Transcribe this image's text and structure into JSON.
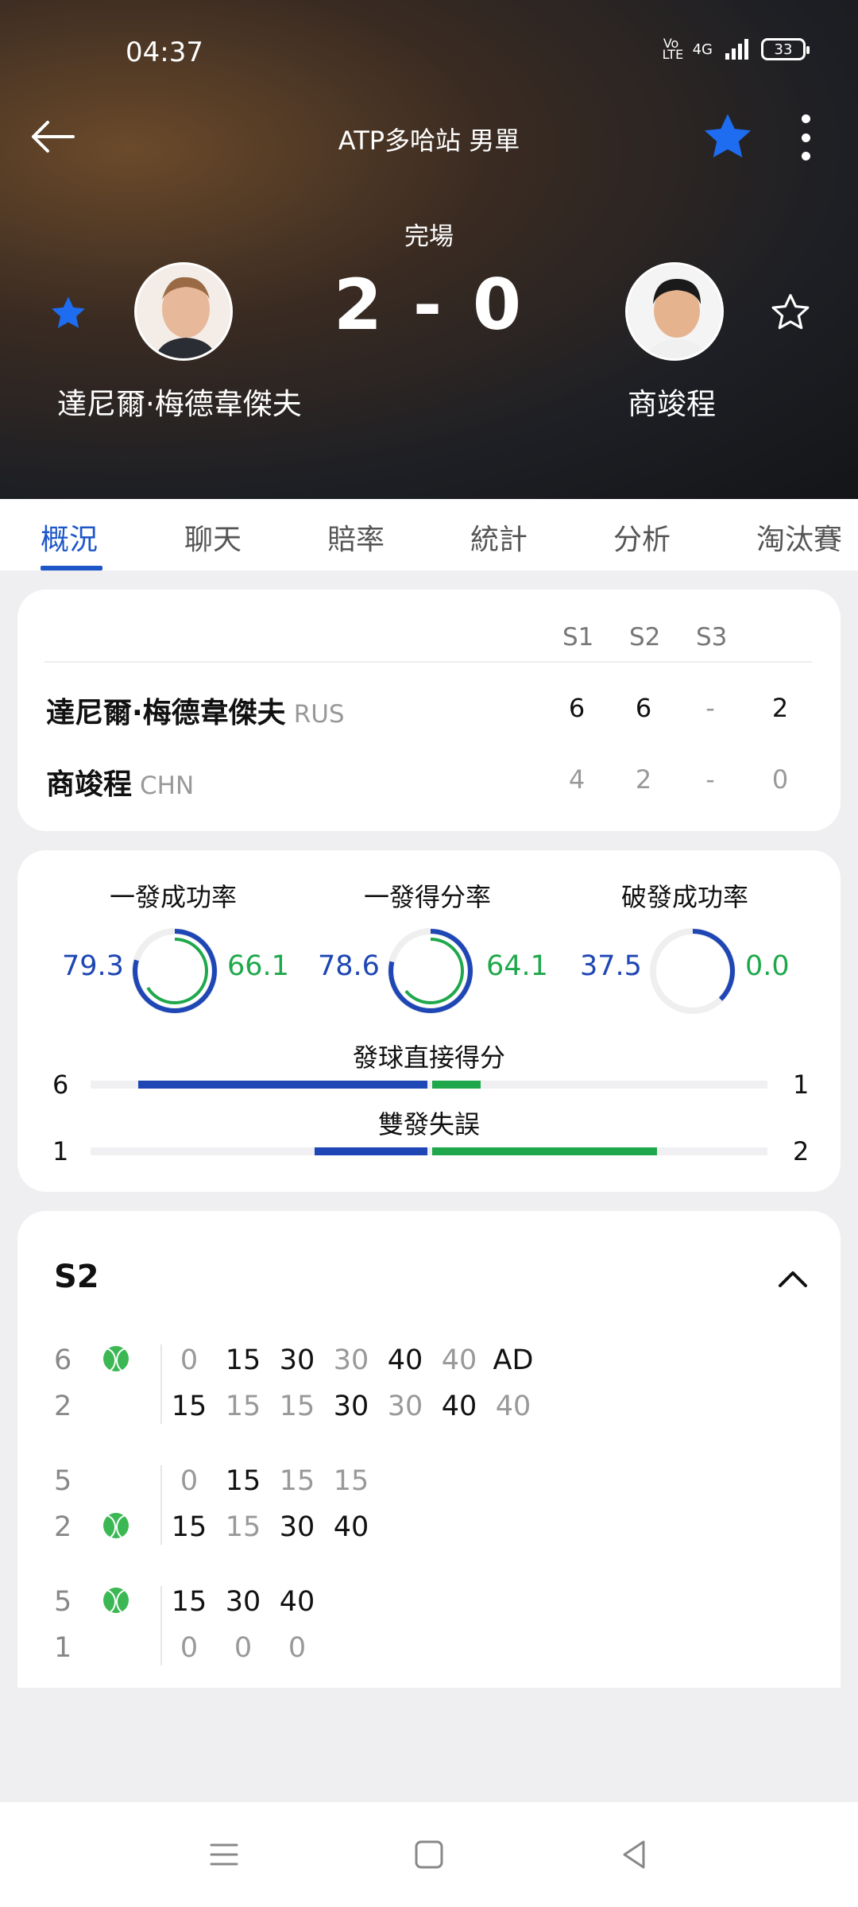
{
  "status_bar": {
    "time": "04:37",
    "network": "4G",
    "volte": "Vo LTE",
    "battery": "33"
  },
  "header": {
    "title": "ATP多哈站 男單",
    "match_status": "完場",
    "score": "2 - 0",
    "player1": {
      "name": "達尼爾·梅德韋傑夫"
    },
    "player2": {
      "name": "商竣程"
    }
  },
  "tabs": [
    "概況",
    "聊天",
    "賠率",
    "統計",
    "分析",
    "淘汰賽"
  ],
  "sets_card": {
    "headers": [
      "S1",
      "S2",
      "S3"
    ],
    "rows": [
      {
        "name": "達尼爾·梅德韋傑夫",
        "country": "RUS",
        "s1": "6",
        "s2": "6",
        "s3": "-",
        "total": "2"
      },
      {
        "name": "商竣程",
        "country": "CHN",
        "s1": "4",
        "s2": "2",
        "s3": "-",
        "total": "0"
      }
    ]
  },
  "stats_card": {
    "rings": [
      {
        "label": "一發成功率",
        "left": "79.3",
        "right": "66.1"
      },
      {
        "label": "一發得分率",
        "left": "78.6",
        "right": "64.1"
      },
      {
        "label": "破發成功率",
        "left": "37.5",
        "right": "0.0"
      }
    ],
    "bars": [
      {
        "label": "發球直接得分",
        "left": "6",
        "right": "1"
      },
      {
        "label": "雙發失誤",
        "left": "1",
        "right": "2"
      }
    ]
  },
  "set_detail": {
    "title": "S2",
    "games": [
      {
        "top_score": "6",
        "bottom_score": "2",
        "top_points": [
          "0",
          "15",
          "30",
          "30",
          "40",
          "40",
          "AD"
        ],
        "bottom_points": [
          "15",
          "15",
          "15",
          "30",
          "30",
          "40",
          "40"
        ]
      },
      {
        "top_score": "5",
        "bottom_score": "2",
        "top_points": [
          "0",
          "15",
          "15",
          "15"
        ],
        "bottom_points": [
          "15",
          "15",
          "30",
          "40"
        ]
      },
      {
        "top_score": "5",
        "bottom_score": "1",
        "top_points": [
          "15",
          "30",
          "40"
        ],
        "bottom_points": [
          "0",
          "0",
          "0"
        ]
      }
    ]
  },
  "colors": {
    "blue": "#1e46b4",
    "green": "#1fa84b",
    "star_blue": "#1e6cf0"
  }
}
